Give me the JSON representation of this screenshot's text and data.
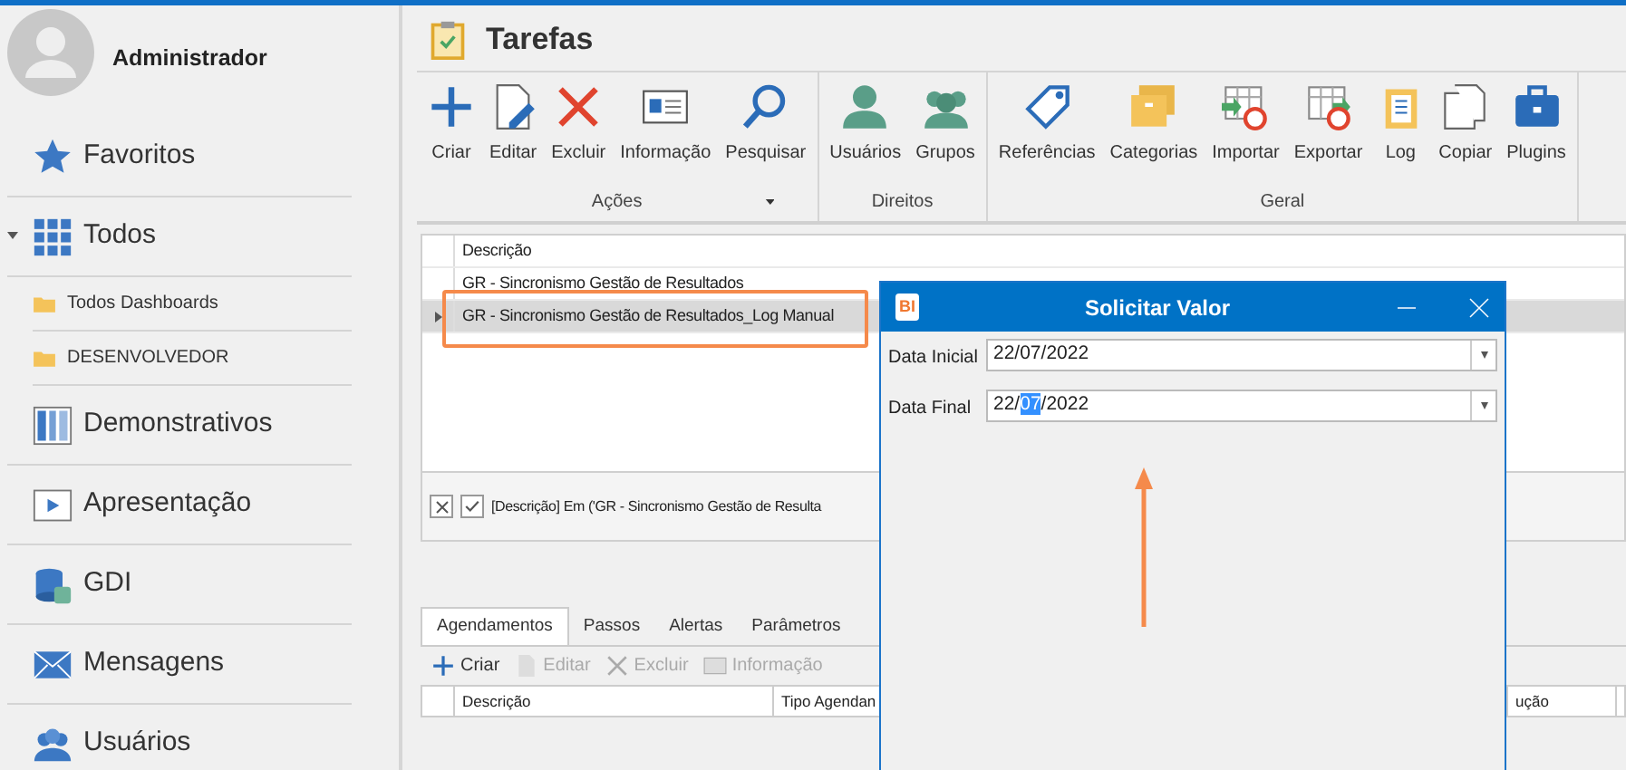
{
  "user": {
    "name": "Administrador"
  },
  "sidebar": {
    "items": [
      {
        "label": "Favoritos",
        "expanded": false
      },
      {
        "label": "Todos",
        "expanded": true,
        "children": [
          {
            "label": "Todos Dashboards"
          },
          {
            "label": "DESENVOLVEDOR"
          }
        ]
      },
      {
        "label": "Demonstrativos",
        "expanded": false
      },
      {
        "label": "Apresentação",
        "expanded": false
      },
      {
        "label": "GDI",
        "expanded": false
      },
      {
        "label": "Mensagens",
        "expanded": false
      },
      {
        "label": "Usuários",
        "expanded": false
      }
    ]
  },
  "page": {
    "title": "Tarefas"
  },
  "ribbon": {
    "groups": [
      {
        "label": "Ações",
        "buttons": [
          {
            "label": "Criar",
            "dropdown": false
          },
          {
            "label": "Editar",
            "dropdown": false
          },
          {
            "label": "Excluir",
            "dropdown": false
          },
          {
            "label": "Informação",
            "dropdown": false
          },
          {
            "label": "Pesquisar",
            "dropdown": true
          }
        ]
      },
      {
        "label": "Direitos",
        "buttons": [
          {
            "label": "Usuários",
            "dropdown": false
          },
          {
            "label": "Grupos",
            "dropdown": false
          }
        ]
      },
      {
        "label": "Geral",
        "buttons": [
          {
            "label": "Referências",
            "dropdown": false
          },
          {
            "label": "Categorias",
            "dropdown": false
          },
          {
            "label": "Importar",
            "dropdown": false
          },
          {
            "label": "Exportar",
            "dropdown": false
          },
          {
            "label": "Log",
            "dropdown": false
          },
          {
            "label": "Copiar",
            "dropdown": false
          },
          {
            "label": "Plugins",
            "dropdown": false
          }
        ]
      }
    ]
  },
  "table": {
    "columns": [
      "Descrição"
    ],
    "rows": [
      {
        "cells": [
          "GR - Sincronismo Gestão de Resultados"
        ],
        "selected": false
      },
      {
        "cells": [
          "GR - Sincronismo Gestão de Resultados_Log Manual"
        ],
        "selected": true
      }
    ]
  },
  "filter": {
    "checked": true,
    "text": "[Descrição] Em ('GR - Sincronismo Gestão de Resulta"
  },
  "detail": {
    "tabs": [
      {
        "label": "Agendamentos",
        "selected": true
      },
      {
        "label": "Passos",
        "selected": false
      },
      {
        "label": "Alertas",
        "selected": false
      },
      {
        "label": "Parâmetros",
        "selected": false
      }
    ],
    "toolbar": [
      {
        "label": "Criar",
        "disabled": false
      },
      {
        "label": "Editar",
        "disabled": true
      },
      {
        "label": "Excluir",
        "disabled": true
      },
      {
        "label": "Informação",
        "disabled": true
      }
    ],
    "columns": [
      "Descrição",
      "Tipo Agendan",
      "ução"
    ]
  },
  "dialog": {
    "logo": "BI",
    "title": "Solicitar Valor",
    "fields": [
      {
        "label": "Data Inicial",
        "parts": [
          {
            "text": "22/07/2022",
            "selected": false
          }
        ]
      },
      {
        "label": "Data Final",
        "parts": [
          {
            "text": "22/",
            "selected": false
          },
          {
            "text": "07",
            "selected": true
          },
          {
            "text": "/2022",
            "selected": false
          }
        ]
      }
    ]
  }
}
